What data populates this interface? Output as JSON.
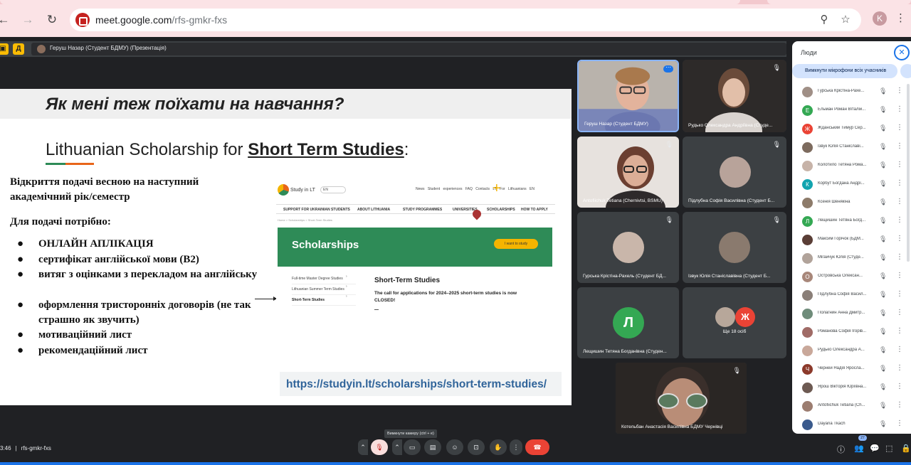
{
  "browser": {
    "url_host": "meet.google.com",
    "url_path": "/rfs-gmkr-fxs",
    "profile_initial": "K"
  },
  "presenter_bar": {
    "label": "Геруш Назар (Студент БДМУ) (Презентація)"
  },
  "slide": {
    "question_title": "Як мені теж поїхати на навчання?",
    "subtitle_plain": "Lithuanian Scholarship for ",
    "subtitle_bold": "Short Term Studies",
    "subtitle_end": ":",
    "para1_line1": "Відкриття подачі весною на наступний",
    "para1_line2": "академічний рік/семестр",
    "para2": "Для подачі потрібно:",
    "bullets": [
      "ОНЛАЙН АПЛІКАЦІЯ",
      "сертифікат англійської мови (В2)",
      "витяг з оцінками з перекладом на англійську",
      "оформлення тристоронніх договорів (не так страшно як звучить)",
      "мотиваційний лист",
      "рекомендаційний лист"
    ],
    "link": "https://studyin.lt/scholarships/short-term-studies/"
  },
  "website": {
    "brand": "Study in LT",
    "lang": "EN",
    "toplinks": "News  Student experiences  FAQ  Contacts  LT For Lithuanians  EN",
    "menu": [
      "SUPPORT FOR UKRAINIAN STUDENTS",
      "ABOUT LITHUANIA",
      "STUDY PROGRAMMES",
      "UNIVERSITIES",
      "SCHOLARSHIPS",
      "HOW TO APPLY"
    ],
    "crumbs": "Home > Scholarships > Short-Term Studies",
    "hero_title": "Scholarships",
    "hero_cta": "I want to study",
    "side_items": [
      "Full-time Master Degree Studies",
      "Lithuanian Summer Term Studies",
      "Short-Term Studies"
    ],
    "section_title": "Short-Term Studies",
    "section_text": "The call for applications for 2024–2025 short-term studies is now CLOSED!"
  },
  "tiles": [
    {
      "name": "Геруш Назар (Студент БДМУ)"
    },
    {
      "name": "Рудько Олександра Андріївна (Студе..."
    },
    {
      "name": "Antofiichuk Tetiana (Chernivtsi, BSMU)"
    },
    {
      "name": "Підлубна Софія Василівна (Студент Б..."
    },
    {
      "name": "Гурська Крістіна-Рахель (Студент БД..."
    },
    {
      "name": "Ізвук Юлія Станіславівна (Студент Б..."
    },
    {
      "name": "Лещишин Тетяна Богданівна (Студен...",
      "initial": "Л"
    },
    {
      "name": "Ще 18 осіб",
      "initial": "Ж"
    },
    {
      "name": "Котельбан Анастасія Василівна БДМУ Чернівці"
    }
  ],
  "people_panel": {
    "title": "Люди",
    "mute_all": "Вимкнути мікрофони всіх учасників",
    "people": [
      {
        "name": "Гурська Крістіна-Рахе...",
        "initial": "",
        "color": "#a08f86"
      },
      {
        "name": "Ельман Роман Віталій...",
        "initial": "Е",
        "color": "#34a853"
      },
      {
        "name": "Жданський Тимур Сер...",
        "initial": "Ж",
        "color": "#ea4335"
      },
      {
        "name": "Ізвук Юлія Станіславі...",
        "initial": "",
        "color": "#7d6b5e"
      },
      {
        "name": "Колотило Тетяна Рома...",
        "initial": "",
        "color": "#c7b3a8"
      },
      {
        "name": "Корбут Богдана Андрі...",
        "initial": "К",
        "color": "#12a4af"
      },
      {
        "name": "Ксенія Шенякіна",
        "initial": "",
        "color": "#8d7b6a"
      },
      {
        "name": "Лещишин Тетяна Богд...",
        "initial": "Л",
        "color": "#34a853"
      },
      {
        "name": "Максим Горічок (БДМ...",
        "initial": "",
        "color": "#5a3e36"
      },
      {
        "name": "Мігайчук Юлія (Студе...",
        "initial": "",
        "color": "#b1a39a"
      },
      {
        "name": "Островська Олексан...",
        "initial": "О",
        "color": "#a8877a"
      },
      {
        "name": "Підлубна Софія Васил...",
        "initial": "",
        "color": "#8a7f78"
      },
      {
        "name": "Полагнин Анна Дмитр...",
        "initial": "",
        "color": "#6f8c7a"
      },
      {
        "name": "Романова Софія Ігорів...",
        "initial": "",
        "color": "#a06b66"
      },
      {
        "name": "Рудько Олександра А...",
        "initial": "",
        "color": "#c9a89a"
      },
      {
        "name": "Черней Надія Яросла...",
        "initial": "Ч",
        "color": "#8c3a2b"
      },
      {
        "name": "Ярош Вікторія Юріївна...",
        "initial": "",
        "color": "#6d5a52"
      },
      {
        "name": "Antofiichuk Tetiana (Ch...",
        "initial": "",
        "color": "#9c7d70"
      },
      {
        "name": "Dayana Tkach",
        "initial": "",
        "color": "#3a5a8c"
      }
    ]
  },
  "bottom_bar": {
    "time": "3:46",
    "meeting_code": "rfs-gmkr-fxs",
    "tooltip": "Вимкнути камеру (ctrl + e)",
    "participants_badge": "27"
  }
}
